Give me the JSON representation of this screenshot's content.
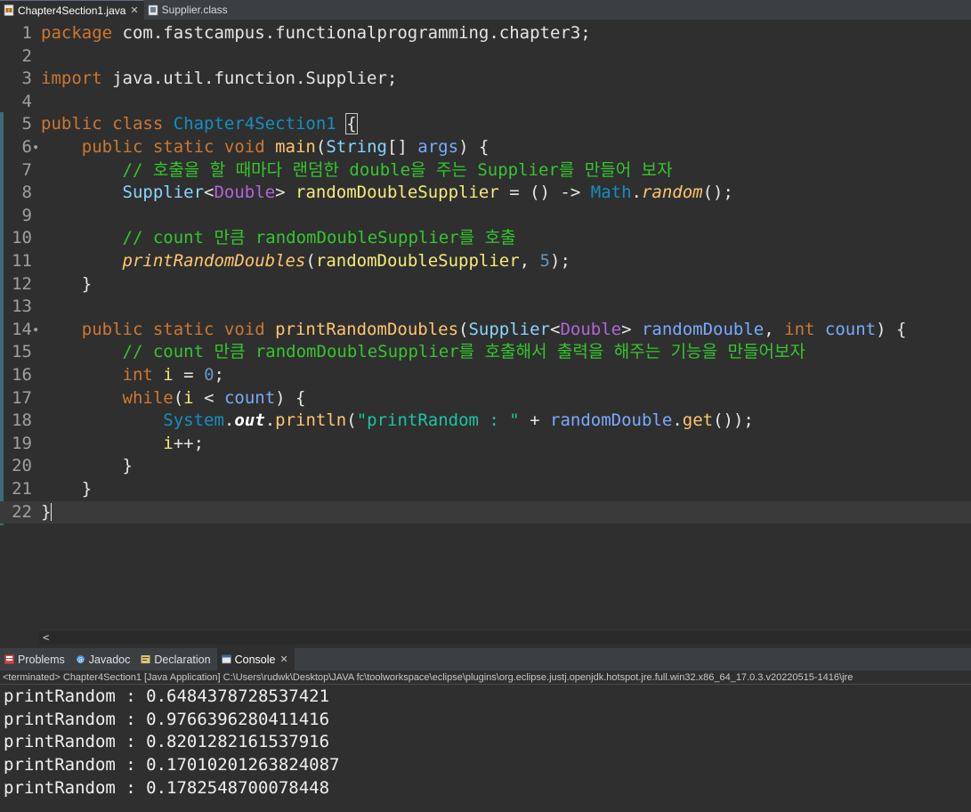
{
  "editor_tabs": [
    {
      "label": "Chapter4Section1.java",
      "active": true,
      "icon": "java-file-icon"
    },
    {
      "label": "Supplier.class",
      "active": false,
      "icon": "class-file-icon"
    }
  ],
  "code_lines": [
    {
      "n": "1",
      "tokens": [
        [
          "kw",
          "package"
        ],
        [
          "pl",
          " com.fastcampus.functionalprogramming.chapter3;"
        ]
      ]
    },
    {
      "n": "2",
      "tokens": []
    },
    {
      "n": "3",
      "tokens": [
        [
          "kw",
          "import"
        ],
        [
          "pl",
          " java.util.function.Supplier;"
        ]
      ]
    },
    {
      "n": "4",
      "tokens": []
    },
    {
      "n": "5",
      "tokens": [
        [
          "kw",
          "public class "
        ],
        [
          "cls",
          "Chapter4Section1 "
        ],
        [
          "brace",
          "{"
        ]
      ]
    },
    {
      "n": "6",
      "fold": true,
      "tokens": [
        [
          "pl",
          "    "
        ],
        [
          "kw",
          "public static void "
        ],
        [
          "fn",
          "main"
        ],
        [
          "pl",
          "("
        ],
        [
          "type",
          "String"
        ],
        [
          "pl",
          "[] "
        ],
        [
          "param",
          "args"
        ],
        [
          "pl",
          ") {"
        ]
      ]
    },
    {
      "n": "7",
      "tokens": [
        [
          "pl",
          "        "
        ],
        [
          "cmt",
          "// 호출을 할 때마다 랜덤한 double을 주는 Supplier를 만들어 보자"
        ]
      ]
    },
    {
      "n": "8",
      "tokens": [
        [
          "pl",
          "        "
        ],
        [
          "type",
          "Supplier"
        ],
        [
          "pl",
          "<"
        ],
        [
          "tp",
          "Double"
        ],
        [
          "pl",
          "> "
        ],
        [
          "var",
          "randomDoubleSupplier"
        ],
        [
          "pl",
          " = () -> "
        ],
        [
          "cls",
          "Math"
        ],
        [
          "pl",
          "."
        ],
        [
          "mfn",
          "random"
        ],
        [
          "pl",
          "();"
        ]
      ]
    },
    {
      "n": "9",
      "tokens": []
    },
    {
      "n": "10",
      "tokens": [
        [
          "pl",
          "        "
        ],
        [
          "cmt",
          "// count 만큼 randomDoubleSupplier를 호출"
        ]
      ]
    },
    {
      "n": "11",
      "tokens": [
        [
          "pl",
          "        "
        ],
        [
          "sfn",
          "printRandomDoubles"
        ],
        [
          "pl",
          "("
        ],
        [
          "var",
          "randomDoubleSupplier"
        ],
        [
          "pl",
          ", "
        ],
        [
          "num",
          "5"
        ],
        [
          "pl",
          ");"
        ]
      ]
    },
    {
      "n": "12",
      "tokens": [
        [
          "pl",
          "    }"
        ]
      ]
    },
    {
      "n": "13",
      "tokens": []
    },
    {
      "n": "14",
      "fold": true,
      "tokens": [
        [
          "pl",
          "    "
        ],
        [
          "kw",
          "public static void "
        ],
        [
          "fn",
          "printRandomDoubles"
        ],
        [
          "pl",
          "("
        ],
        [
          "type",
          "Supplier"
        ],
        [
          "pl",
          "<"
        ],
        [
          "tp",
          "Double"
        ],
        [
          "pl",
          "> "
        ],
        [
          "param",
          "randomDouble"
        ],
        [
          "pl",
          ", "
        ],
        [
          "kw",
          "int "
        ],
        [
          "param",
          "count"
        ],
        [
          "pl",
          ") {"
        ]
      ]
    },
    {
      "n": "15",
      "tokens": [
        [
          "pl",
          "        "
        ],
        [
          "cmt",
          "// count 만큼 randomDoubleSupplier를 호출해서 출력을 해주는 기능을 만들어보자"
        ]
      ]
    },
    {
      "n": "16",
      "tokens": [
        [
          "pl",
          "        "
        ],
        [
          "kw",
          "int "
        ],
        [
          "var",
          "i"
        ],
        [
          "pl",
          " = "
        ],
        [
          "num",
          "0"
        ],
        [
          "pl",
          ";"
        ]
      ]
    },
    {
      "n": "17",
      "tokens": [
        [
          "pl",
          "        "
        ],
        [
          "kw",
          "while"
        ],
        [
          "pl",
          "("
        ],
        [
          "var",
          "i"
        ],
        [
          "pl",
          " < "
        ],
        [
          "param",
          "count"
        ],
        [
          "pl",
          ") {"
        ]
      ]
    },
    {
      "n": "18",
      "tokens": [
        [
          "pl",
          "            "
        ],
        [
          "cls",
          "System"
        ],
        [
          "pl",
          "."
        ],
        [
          "fld",
          "out"
        ],
        [
          "pl",
          "."
        ],
        [
          "fn",
          "println"
        ],
        [
          "pl",
          "("
        ],
        [
          "str",
          "\"printRandom : \""
        ],
        [
          "pl",
          " + "
        ],
        [
          "param",
          "randomDouble"
        ],
        [
          "pl",
          "."
        ],
        [
          "fn",
          "get"
        ],
        [
          "pl",
          "());"
        ]
      ]
    },
    {
      "n": "19",
      "tokens": [
        [
          "pl",
          "            "
        ],
        [
          "var",
          "i"
        ],
        [
          "pl",
          "++;"
        ]
      ]
    },
    {
      "n": "20",
      "tokens": [
        [
          "pl",
          "        }"
        ]
      ]
    },
    {
      "n": "21",
      "tokens": [
        [
          "pl",
          "    }"
        ]
      ]
    },
    {
      "n": "22",
      "current": true,
      "tokens": [
        [
          "pl",
          "}"
        ],
        [
          "caret",
          ""
        ]
      ]
    }
  ],
  "view_tabs": [
    {
      "label": "Problems",
      "icon": "problems-icon",
      "active": false
    },
    {
      "label": "Javadoc",
      "icon": "javadoc-icon",
      "active": false
    },
    {
      "label": "Declaration",
      "icon": "declaration-icon",
      "active": false
    },
    {
      "label": "Console",
      "icon": "console-icon",
      "active": true,
      "closable": true
    }
  ],
  "console": {
    "header": "<terminated> Chapter4Section1 [Java Application] C:\\Users\\rudwk\\Desktop\\JAVA fc\\toolworkspace\\eclipse\\plugins\\org.eclipse.justj.openjdk.hotspot.jre.full.win32.x86_64_17.0.3.v20220515-1416\\jre",
    "output": [
      "printRandom : 0.6484378728537421",
      "printRandom : 0.9766396280411416",
      "printRandom : 0.8201282161537916",
      "printRandom : 0.17010201263824087",
      "printRandom : 0.1782548700078448"
    ]
  },
  "colors": {
    "background": "#2f2f2f",
    "keyword": "#cc7832",
    "comment": "#36c52f",
    "string": "#17c6a3"
  },
  "close_glyph": "✕",
  "scroll_left_glyph": "<"
}
